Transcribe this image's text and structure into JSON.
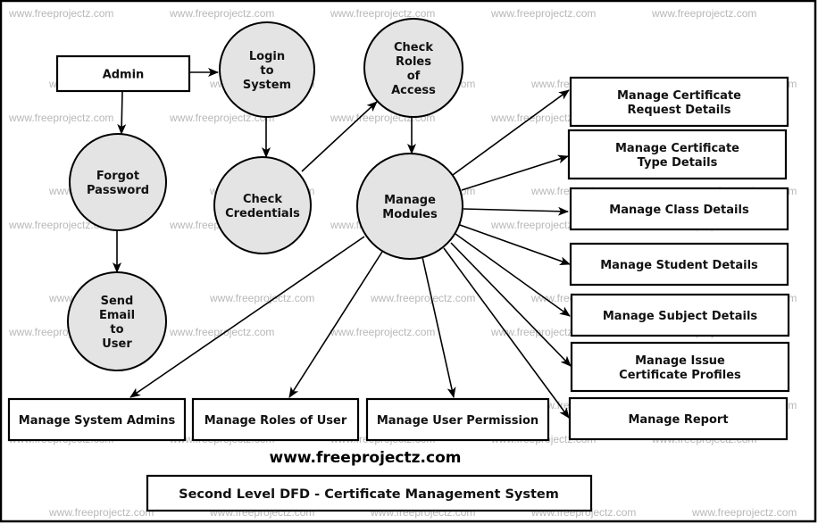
{
  "diagram": {
    "type": "Data Flow Diagram",
    "title": "Second Level DFD - Certificate Management System",
    "website": "www.freeprojectz.com",
    "watermark": "www.freeprojectz.com",
    "entities": [
      {
        "id": "admin",
        "label": "Admin"
      }
    ],
    "processes": [
      {
        "id": "login",
        "lines": [
          "Login",
          "to",
          "System"
        ]
      },
      {
        "id": "check_roles",
        "lines": [
          "Check",
          "Roles",
          "of",
          "Access"
        ]
      },
      {
        "id": "forgot",
        "lines": [
          "Forgot",
          "Password"
        ]
      },
      {
        "id": "check_cred",
        "lines": [
          "Check",
          "Credentials"
        ]
      },
      {
        "id": "manage_modules",
        "lines": [
          "Manage",
          "Modules"
        ]
      },
      {
        "id": "send_email",
        "lines": [
          "Send",
          "Email",
          "to",
          "User"
        ]
      }
    ],
    "stores": [
      {
        "id": "cert_request",
        "lines": [
          "Manage Certificate",
          "Request Details"
        ]
      },
      {
        "id": "cert_type",
        "lines": [
          "Manage Certificate",
          "Type Details"
        ]
      },
      {
        "id": "class",
        "lines": [
          "Manage Class Details"
        ]
      },
      {
        "id": "student",
        "lines": [
          "Manage Student Details"
        ]
      },
      {
        "id": "subject",
        "lines": [
          "Manage Subject Details"
        ]
      },
      {
        "id": "issue_cert",
        "lines": [
          "Manage Issue",
          "Certificate Profiles"
        ]
      },
      {
        "id": "report",
        "lines": [
          "Manage Report"
        ]
      },
      {
        "id": "sys_admins",
        "lines": [
          "Manage System Admins"
        ]
      },
      {
        "id": "roles_user",
        "lines": [
          "Manage Roles of User"
        ]
      },
      {
        "id": "user_perm",
        "lines": [
          "Manage User Permission"
        ]
      }
    ],
    "flows": [
      {
        "from": "admin",
        "to": "login"
      },
      {
        "from": "admin",
        "to": "forgot"
      },
      {
        "from": "forgot",
        "to": "send_email"
      },
      {
        "from": "login",
        "to": "check_cred"
      },
      {
        "from": "check_cred",
        "to": "check_roles"
      },
      {
        "from": "check_roles",
        "to": "manage_modules"
      },
      {
        "from": "manage_modules",
        "to": "cert_request"
      },
      {
        "from": "manage_modules",
        "to": "cert_type"
      },
      {
        "from": "manage_modules",
        "to": "class"
      },
      {
        "from": "manage_modules",
        "to": "student"
      },
      {
        "from": "manage_modules",
        "to": "subject"
      },
      {
        "from": "manage_modules",
        "to": "issue_cert"
      },
      {
        "from": "manage_modules",
        "to": "report"
      },
      {
        "from": "manage_modules",
        "to": "sys_admins"
      },
      {
        "from": "manage_modules",
        "to": "roles_user"
      },
      {
        "from": "manage_modules",
        "to": "user_perm"
      }
    ]
  }
}
